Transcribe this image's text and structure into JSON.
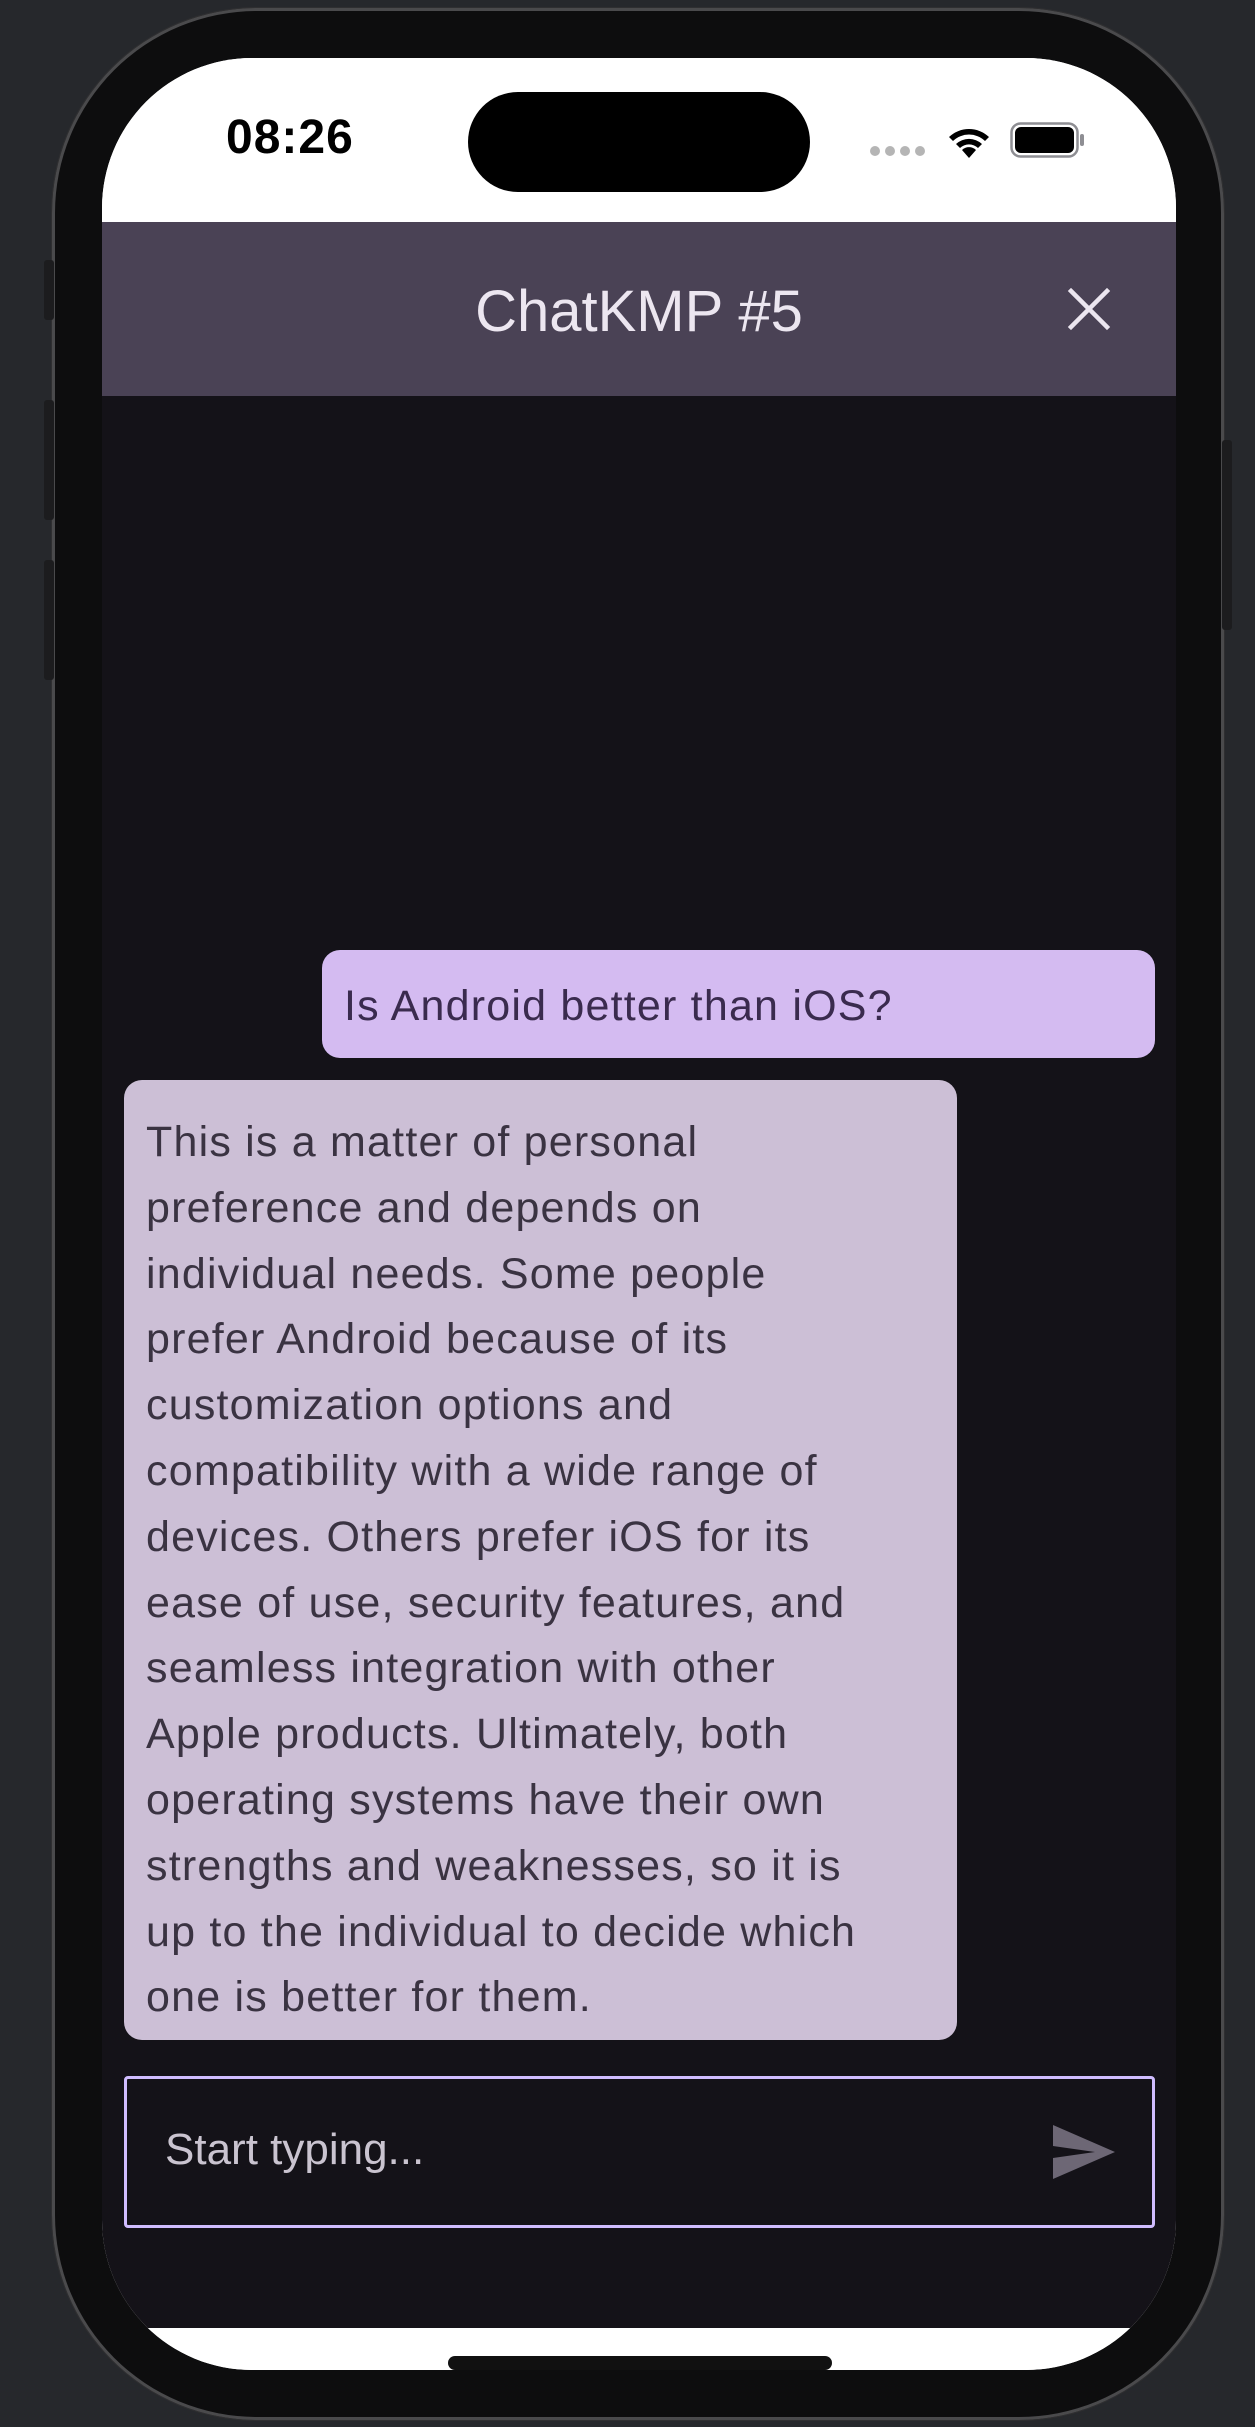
{
  "status_bar": {
    "time": "08:26"
  },
  "app_bar": {
    "title": "ChatKMP #5",
    "close_icon": "close-icon"
  },
  "messages": [
    {
      "role": "user",
      "text": "Is Android better than iOS?"
    },
    {
      "role": "assistant",
      "lines": [
        "This is a matter of personal",
        "preference and depends on",
        "individual needs. Some people",
        "prefer Android because of its",
        "customization options and",
        "compatibility with a wide range of",
        "devices. Others prefer iOS for its",
        "ease of use, security features, and",
        "seamless integration with other",
        "Apple products. Ultimately, both",
        "operating systems have their own",
        "strengths and weaknesses, so it is",
        "up to the individual to decide which",
        "one is better for them."
      ]
    }
  ],
  "composer": {
    "placeholder": "Start typing...",
    "value": "",
    "send_icon": "send-icon"
  },
  "colors": {
    "app_bar": "#4a4255",
    "background": "#141218",
    "user_bubble": "#d4bbf1",
    "assistant_bubble": "#ccbfd6",
    "input_border": "#d0bcff"
  }
}
